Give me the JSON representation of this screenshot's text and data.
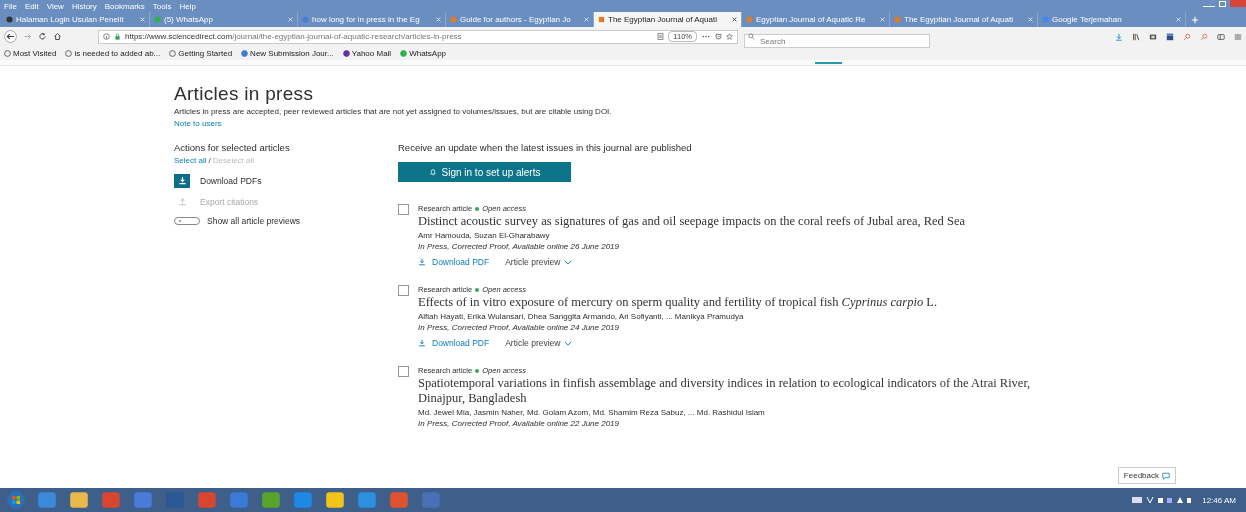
{
  "browser": {
    "menu": [
      "File",
      "Edit",
      "View",
      "History",
      "Bookmarks",
      "Tools",
      "Help"
    ],
    "tabs": [
      {
        "title": "Halaman Login Usulan Penelit",
        "selected": false
      },
      {
        "title": "(5) WhatsApp",
        "selected": false
      },
      {
        "title": "how long for in press in the Eg",
        "selected": false
      },
      {
        "title": "Guide for authors - Egyptian Jo",
        "selected": false
      },
      {
        "title": "The Egyptian Journal of Aquati",
        "selected": true
      },
      {
        "title": "Egyptian Journal of Aquatic Re",
        "selected": false
      },
      {
        "title": "The Egyptian Journal of Aquati",
        "selected": false
      },
      {
        "title": "Google Terjemahan",
        "selected": false
      }
    ],
    "url_host": "https://www.sciencedirect.com",
    "url_path": "/journal/the-egyptian-journal-of-aquatic-research/articles-in-press",
    "zoom": "110%",
    "search_placeholder": "Search",
    "bookmarks": [
      "Most Visited",
      "is needed to added ab...",
      "Getting Started",
      "New Submission Jour...",
      "Yahoo Mail",
      "WhatsApp"
    ]
  },
  "page": {
    "title": "Articles in press",
    "description": "Articles in press are accepted, peer reviewed articles that are not yet assigned to volumes/issues, but are citable using DOI.",
    "note_link": "Note to users",
    "actions": {
      "heading": "Actions for selected articles",
      "select_all": "Select all",
      "separator": "/",
      "deselect_all": "Deselect all",
      "items": [
        {
          "label": "Download PDFs",
          "disabled": false
        },
        {
          "label": "Export citations",
          "disabled": true
        }
      ],
      "toggle": {
        "label": "Show all article previews",
        "on": false
      }
    },
    "alerts": {
      "text": "Receive an update when the latest issues in this journal are published",
      "button": "Sign in to set up alerts"
    },
    "articles": [
      {
        "checked": false,
        "type": "Research article",
        "access": "Open access",
        "title": "Distinct acoustic survey as signatures of gas and oil seepage impacts on the coral reefs of Jubal area, Red Sea",
        "authors": "Amr Hamouda, Suzan El-Gharabawy",
        "date": "In Press, Corrected Proof, Available online 26 June 2019",
        "download": "Download PDF",
        "preview": "Article preview"
      },
      {
        "checked": false,
        "type": "Research article",
        "access": "Open access",
        "title": "Effects of in vitro exposure of mercury on sperm quality and fertility of tropical fish *Cyprinus carpio* L.",
        "authors": "Alfiah Hayati, Erika Wulansari, Dhea Sanggita Armando, Ari Sofiyanti, ... Manikya Pramudya",
        "date": "In Press, Corrected Proof, Available online 24 June 2019",
        "download": "Download PDF",
        "preview": "Article preview"
      },
      {
        "checked": false,
        "type": "Research article",
        "access": "Open access",
        "title": "Spatiotemporal variations in finfish assemblage and diversity indices in relation to ecological indicators of the Atrai River, Dinajpur, Bangladesh",
        "authors": "Md. Jewel Mia, Jasmin Naher, Md. Golam Azom, Md. Shamim Reza Sabuz, ... Md. Rashidul Islam",
        "date": "In Press, Corrected Proof, Available online 22 June 2019"
      }
    ],
    "feedback": "Feedback"
  },
  "taskbar": {
    "clock": "12:46 AM"
  }
}
